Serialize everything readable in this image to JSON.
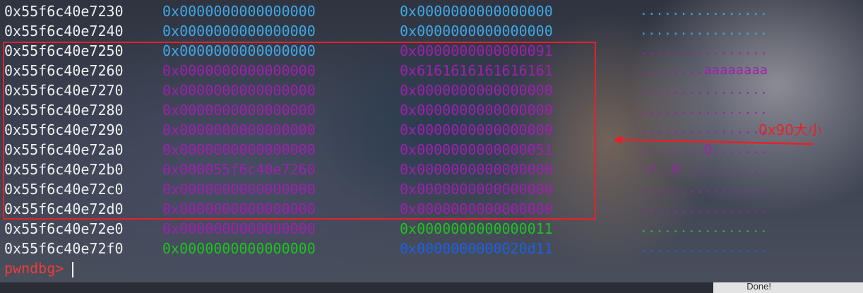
{
  "terminal": {
    "rows": [
      {
        "addr": "0x55f6c40e7230",
        "v1": "0x0000000000000000",
        "v1_color": "cyan",
        "v2": "0x0000000000000000",
        "v2_color": "cyan",
        "ascii": "................",
        "ascii_color": "cyan"
      },
      {
        "addr": "0x55f6c40e7240",
        "v1": "0x0000000000000000",
        "v1_color": "cyan",
        "v2": "0x0000000000000000",
        "v2_color": "cyan",
        "ascii": "................",
        "ascii_color": "cyan"
      },
      {
        "addr": "0x55f6c40e7250",
        "v1": "0x0000000000000000",
        "v1_color": "cyan",
        "v2": "0x0000000000000091",
        "v2_color": "purple",
        "ascii": "................",
        "ascii_color": "purple"
      },
      {
        "addr": "0x55f6c40e7260",
        "v1": "0x0000000000000000",
        "v1_color": "purple",
        "v2": "0x6161616161616161",
        "v2_color": "purple",
        "ascii": "........aaaaaaaa",
        "ascii_color": "purple"
      },
      {
        "addr": "0x55f6c40e7270",
        "v1": "0x0000000000000000",
        "v1_color": "purple",
        "v2": "0x0000000000000000",
        "v2_color": "purple",
        "ascii": "................",
        "ascii_color": "purple"
      },
      {
        "addr": "0x55f6c40e7280",
        "v1": "0x0000000000000000",
        "v1_color": "purple",
        "v2": "0x0000000000000000",
        "v2_color": "purple",
        "ascii": "................",
        "ascii_color": "purple"
      },
      {
        "addr": "0x55f6c40e7290",
        "v1": "0x0000000000000000",
        "v1_color": "purple",
        "v2": "0x0000000000000000",
        "v2_color": "purple",
        "ascii": "................",
        "ascii_color": "purple"
      },
      {
        "addr": "0x55f6c40e72a0",
        "v1": "0x0000000000000000",
        "v1_color": "purple",
        "v2": "0x0000000000000051",
        "v2_color": "purple",
        "ascii": "........Q.......",
        "ascii_color": "purple"
      },
      {
        "addr": "0x55f6c40e72b0",
        "v1": "0x000055f6c40e7260",
        "v1_color": "purple",
        "v2": "0x0000000000000000",
        "v2_color": "purple",
        "ascii": "`r..U...........",
        "ascii_color": "purple"
      },
      {
        "addr": "0x55f6c40e72c0",
        "v1": "0x0000000000000000",
        "v1_color": "purple",
        "v2": "0x0000000000000000",
        "v2_color": "purple",
        "ascii": "................",
        "ascii_color": "purple"
      },
      {
        "addr": "0x55f6c40e72d0",
        "v1": "0x0000000000000000",
        "v1_color": "purple",
        "v2": "0x0000000000000000",
        "v2_color": "purple",
        "ascii": "................",
        "ascii_color": "purple"
      },
      {
        "addr": "0x55f6c40e72e0",
        "v1": "0x0000000000000000",
        "v1_color": "purple",
        "v2": "0x0000000000000011",
        "v2_color": "green",
        "ascii": "................",
        "ascii_color": "green"
      },
      {
        "addr": "0x55f6c40e72f0",
        "v1": "0x0000000000000000",
        "v1_color": "green",
        "v2": "0x0000000000020d11",
        "v2_color": "blue",
        "ascii": "................",
        "ascii_color": "blue"
      }
    ],
    "prompt": "pwndbg>"
  },
  "annotation": {
    "label": "0x90大小",
    "color": "#e8202a"
  },
  "status": {
    "right_text": "Done!"
  },
  "colors": {
    "cyan": "#3fa8e6",
    "purple": "#a01fb0",
    "green": "#1fc31f",
    "blue": "#1f5fe0",
    "address": "#eef0f2",
    "prompt": "#ef3b3b"
  }
}
